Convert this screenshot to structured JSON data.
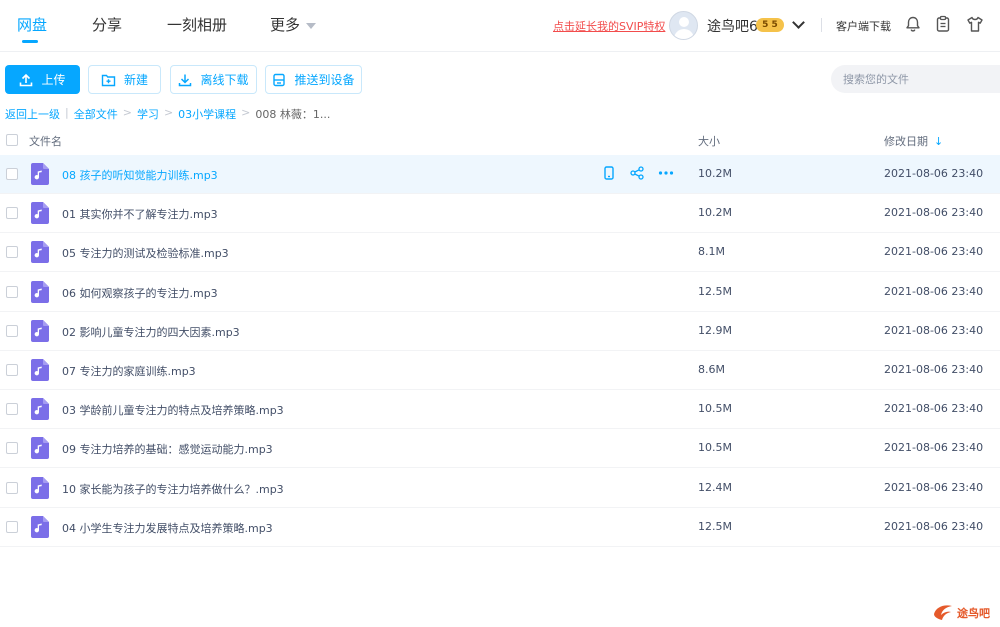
{
  "nav": {
    "items": [
      {
        "label": "网盘",
        "active": true
      },
      {
        "label": "分享",
        "active": false
      },
      {
        "label": "一刻相册",
        "active": false
      },
      {
        "label": "更多",
        "active": false
      }
    ]
  },
  "header": {
    "vip_link": "点击延长我的SVIP特权",
    "username": "途鸟吧6",
    "vip_badge": "5 5",
    "client_download": "客户端下载"
  },
  "toolbar": {
    "upload": "上传",
    "new": "新建",
    "offline": "离线下载",
    "push": "推送到设备",
    "search_placeholder": "搜索您的文件"
  },
  "breadcrumb": {
    "back": "返回上一级",
    "items": [
      "全部文件",
      "学习",
      "03小学课程"
    ],
    "current": "008 林薇：1..."
  },
  "table": {
    "col_name": "文件名",
    "col_size": "大小",
    "col_date": "修改日期",
    "rows": [
      {
        "name": "08 孩子的听知觉能力训练.mp3",
        "size": "10.2M",
        "date": "2021-08-06 23:40"
      },
      {
        "name": "01 其实你并不了解专注力.mp3",
        "size": "10.2M",
        "date": "2021-08-06 23:40"
      },
      {
        "name": "05 专注力的测试及检验标准.mp3",
        "size": "8.1M",
        "date": "2021-08-06 23:40"
      },
      {
        "name": "06 如何观察孩子的专注力.mp3",
        "size": "12.5M",
        "date": "2021-08-06 23:40"
      },
      {
        "name": "02 影响儿童专注力的四大因素.mp3",
        "size": "12.9M",
        "date": "2021-08-06 23:40"
      },
      {
        "name": "07 专注力的家庭训练.mp3",
        "size": "8.6M",
        "date": "2021-08-06 23:40"
      },
      {
        "name": "03 学龄前儿童专注力的特点及培养策略.mp3",
        "size": "10.5M",
        "date": "2021-08-06 23:40"
      },
      {
        "name": "09 专注力培养的基础：感觉运动能力.mp3",
        "size": "10.5M",
        "date": "2021-08-06 23:40"
      },
      {
        "name": "10 家长能为孩子的专注力培养做什么？.mp3",
        "size": "12.4M",
        "date": "2021-08-06 23:40"
      },
      {
        "name": "04 小学生专注力发展特点及培养策略.mp3",
        "size": "12.5M",
        "date": "2021-08-06 23:40"
      }
    ]
  },
  "watermark": {
    "text": "途鸟吧"
  },
  "colors": {
    "accent": "#06a7ff",
    "vip_red": "#f24c4c",
    "file_icon": "#7b6ee8"
  }
}
